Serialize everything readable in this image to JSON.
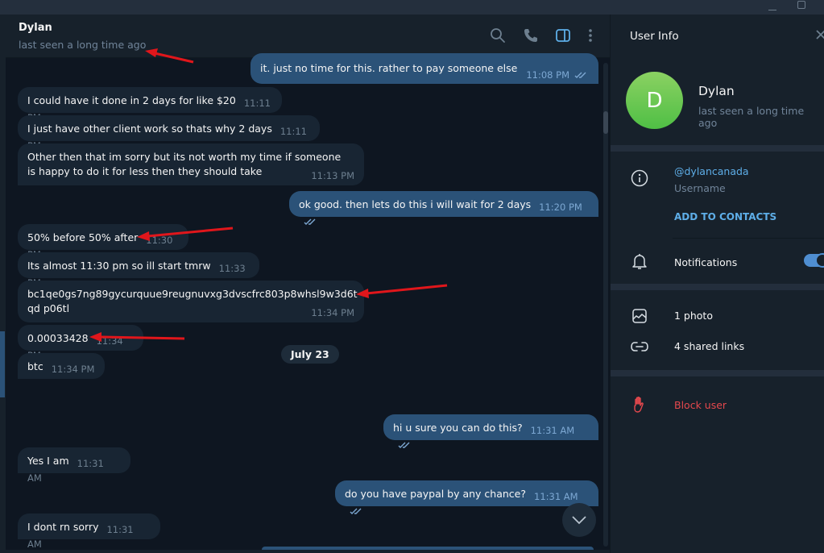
{
  "window": {
    "minimize_icon": "minimize-icon",
    "maximize_icon": "maximize-icon"
  },
  "chat": {
    "title": "Dylan",
    "status": "last seen a long time ago",
    "header_icons": [
      "search-icon",
      "phone-icon",
      "side-panel-icon",
      "more-vertical-icon"
    ],
    "messages": [
      {
        "dir": "out",
        "text": "it. just no time for this. rather to pay someone else",
        "time": "11:08 PM",
        "read": true
      },
      {
        "dir": "in",
        "text": "I could have it done in 2 days for like $20",
        "time": "11:11 PM"
      },
      {
        "dir": "in",
        "text": "I just have other client work so thats why 2 days",
        "time": "11:11 PM"
      },
      {
        "dir": "in",
        "text": "Other then that im sorry but its not worth my time if someone is happy to do it for less then they should take",
        "time": "11:13 PM"
      },
      {
        "dir": "out",
        "text": "ok good. then lets do this i will wait for 2 days",
        "time": "11:20 PM",
        "read": true
      },
      {
        "dir": "in",
        "text": "50% before 50% after",
        "time": "11:30 PM"
      },
      {
        "dir": "in",
        "text": "Its almost 11:30 pm so ill start tmrw",
        "time": "11:33 PM"
      },
      {
        "dir": "in",
        "text": "bc1qe0gs7ng89gycurquue9reugnuvxg3dvscfrc803p8whsl9w3d6tqd p06tl",
        "time": "11:34 PM"
      },
      {
        "dir": "in",
        "text": "0.00033428",
        "time": "11:34 PM"
      },
      {
        "dir": "in",
        "text": "btc",
        "time": "11:34 PM"
      },
      {
        "dir": "out",
        "text": "hi u sure you can do this?",
        "time": "11:31 AM",
        "read": true
      },
      {
        "dir": "in",
        "text": "Yes I am",
        "time": "11:31 AM"
      },
      {
        "dir": "out",
        "text": "do you have paypal by any chance?",
        "time": "11:31 AM",
        "read": true
      },
      {
        "dir": "in",
        "text": "I dont rn sorry",
        "time": "11:31 AM"
      }
    ],
    "date_separator": "July 23",
    "scroll_down_icon": "chevron-down-icon"
  },
  "user_info": {
    "title": "User Info",
    "close_icon": "close-icon",
    "avatar_letter": "D",
    "avatar_color": "#5ec44f",
    "name": "Dylan",
    "status": "last seen a long time ago",
    "username": "@dylancanada",
    "username_label": "Username",
    "add_to_contacts": "ADD TO CONTACTS",
    "notifications_label": "Notifications",
    "notifications_on": true,
    "photos": "1 photo",
    "shared_links": "4 shared links",
    "block_user": "Block user"
  },
  "colors": {
    "accent": "#5eaee8",
    "outgoing_bubble": "#2b5278",
    "incoming_bubble": "#182533",
    "danger": "#e5484d",
    "annotation_arrow": "#e0161b"
  }
}
